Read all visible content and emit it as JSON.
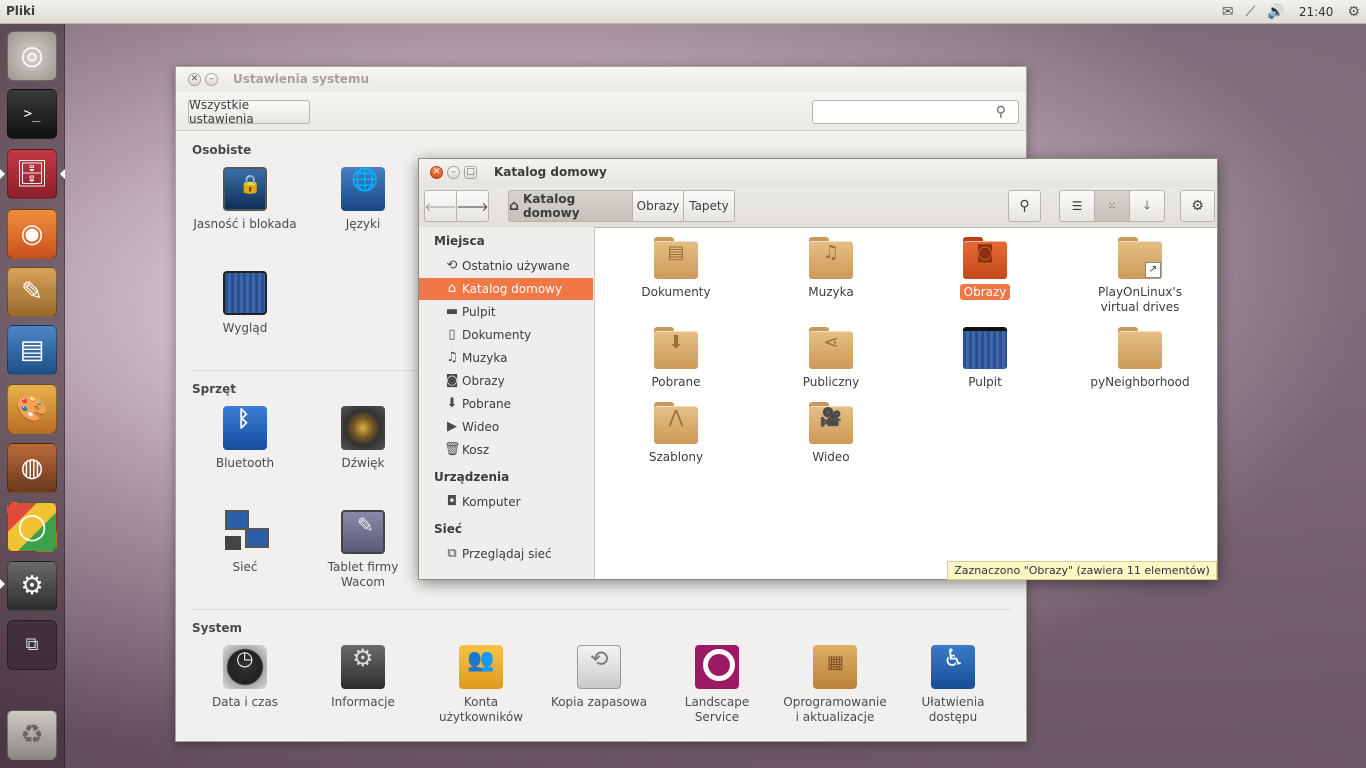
{
  "top_panel": {
    "app_title": "Pliki",
    "clock": "21:40",
    "tray_icons": [
      "mail-icon",
      "network-icon",
      "volume-icon",
      "gear-icon"
    ]
  },
  "launcher": {
    "items": [
      {
        "name": "ubuntu-icon"
      },
      {
        "name": "terminal-icon"
      },
      {
        "name": "files-icon"
      },
      {
        "name": "firefox-icon"
      },
      {
        "name": "text-editor-icon"
      },
      {
        "name": "writer-icon"
      },
      {
        "name": "paint-icon"
      },
      {
        "name": "speaker-icon"
      },
      {
        "name": "app-icon"
      },
      {
        "name": "system-settings-icon"
      },
      {
        "name": "workspaces-icon"
      },
      {
        "name": "trash-icon"
      }
    ]
  },
  "settings": {
    "title": "Ustawienia systemu",
    "all_settings_label": "Wszystkie ustawienia",
    "search_placeholder": "",
    "sections": {
      "personal": "Osobiste",
      "hardware": "Sprzęt",
      "system": "System"
    },
    "personal_items": [
      "Jasność i blokada",
      "Języki",
      "Wygląd"
    ],
    "hardware_items": [
      "Bluetooth",
      "Dźwięk",
      "Sieć",
      "Tablet firmy Wacom"
    ],
    "system_items": [
      "Data i czas",
      "Informacje",
      "Konta użytkowników",
      "Kopia zapasowa",
      "Landscape Service",
      "Oprogramowanie i aktualizacje",
      "Ułatwienia dostępu"
    ]
  },
  "files": {
    "title": "Katalog domowy",
    "breadcrumbs": [
      "Katalog domowy",
      "Obrazy",
      "Tapety"
    ],
    "sidebar": {
      "places_label": "Miejsca",
      "places": [
        "Ostatnio używane",
        "Katalog domowy",
        "Pulpit",
        "Dokumenty",
        "Muzyka",
        "Obrazy",
        "Pobrane",
        "Wideo",
        "Kosz"
      ],
      "devices_label": "Urządzenia",
      "devices": [
        "Komputer"
      ],
      "network_label": "Sieć",
      "network": [
        "Przeglądaj sieć"
      ]
    },
    "items": [
      "Dokumenty",
      "Muzyka",
      "Obrazy",
      "PlayOnLinux's virtual drives",
      "Pobrane",
      "Publiczny",
      "Pulpit",
      "pyNeighborhood",
      "Szablony",
      "Wideo"
    ],
    "selected_item": "Obrazy",
    "status": "Zaznaczono \"Obrazy\"  (zawiera 11 elementów)"
  },
  "colors": {
    "accent": "#f07746",
    "folder": "#d8a868"
  }
}
